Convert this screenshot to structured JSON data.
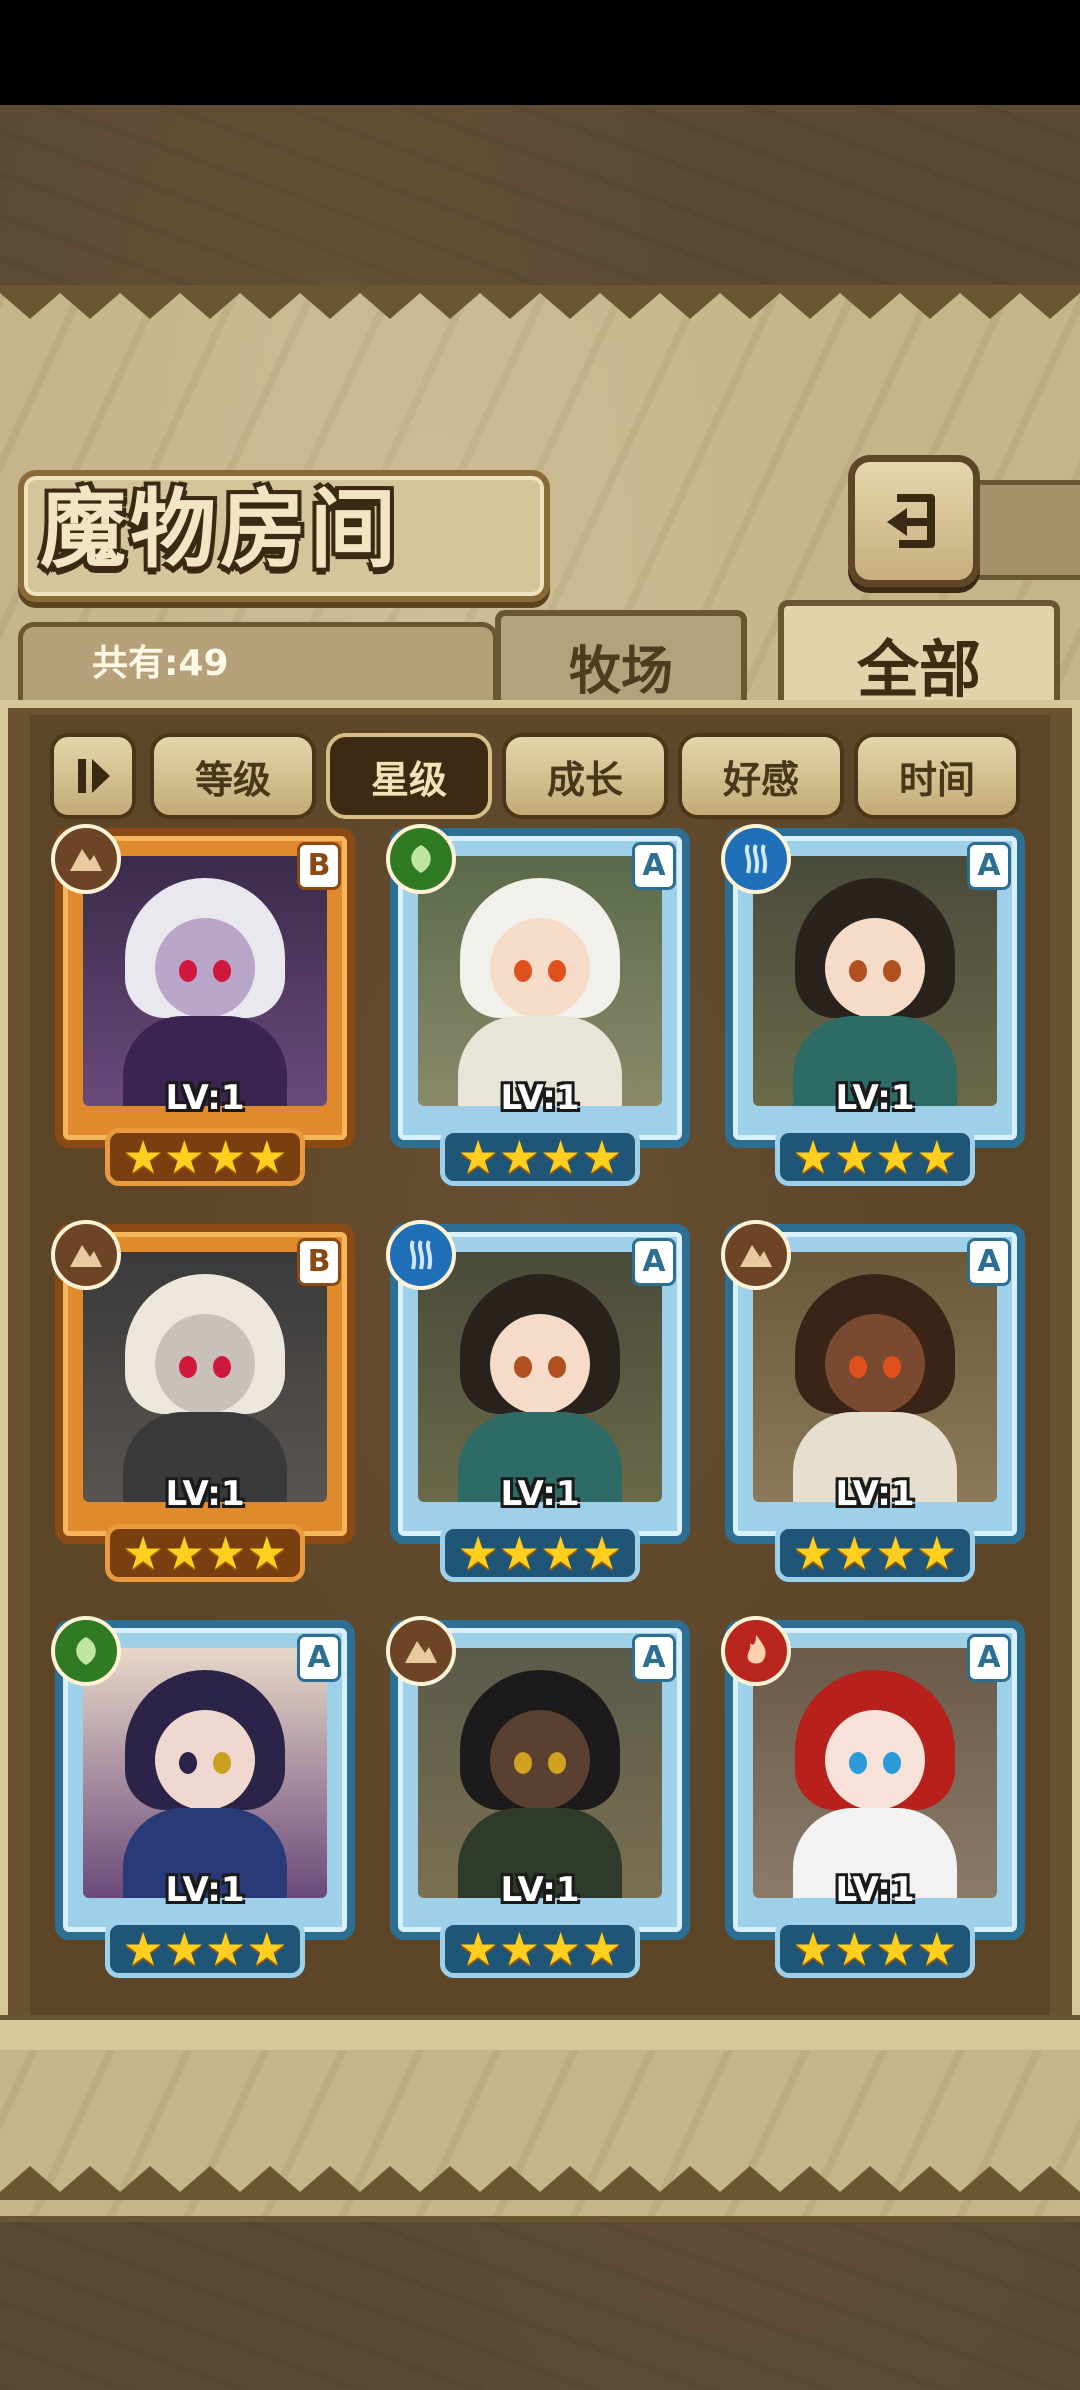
{
  "header": {
    "title": "魔物房间",
    "back_icon": "return-arrow-icon"
  },
  "summary": {
    "count_label": "共有:49"
  },
  "tabs": [
    {
      "label": "牧场",
      "selected": false
    },
    {
      "label": "全部",
      "selected": true
    }
  ],
  "sort": {
    "toggle_icon": "sort-direction-icon",
    "buttons": [
      {
        "label": "等级",
        "active": false
      },
      {
        "label": "星级",
        "active": true
      },
      {
        "label": "成长",
        "active": false
      },
      {
        "label": "好感",
        "active": false
      },
      {
        "label": "时间",
        "active": false
      }
    ]
  },
  "monsters": [
    {
      "grade": "B",
      "level": "LV:1",
      "stars": "★★★★",
      "element": "earth",
      "frame": "orange"
    },
    {
      "grade": "A",
      "level": "LV:1",
      "stars": "★★★★",
      "element": "leaf",
      "frame": "blue"
    },
    {
      "grade": "A",
      "level": "LV:1",
      "stars": "★★★★",
      "element": "water",
      "frame": "blue"
    },
    {
      "grade": "B",
      "level": "LV:1",
      "stars": "★★★★",
      "element": "earth",
      "frame": "orange"
    },
    {
      "grade": "A",
      "level": "LV:1",
      "stars": "★★★★",
      "element": "water",
      "frame": "blue"
    },
    {
      "grade": "A",
      "level": "LV:1",
      "stars": "★★★★",
      "element": "earth",
      "frame": "blue"
    },
    {
      "grade": "A",
      "level": "LV:1",
      "stars": "★★★★",
      "element": "leaf",
      "frame": "blue"
    },
    {
      "grade": "A",
      "level": "LV:1",
      "stars": "★★★★",
      "element": "earth",
      "frame": "blue"
    },
    {
      "grade": "A",
      "level": "LV:1",
      "stars": "★★★★",
      "element": "fire",
      "frame": "blue"
    }
  ],
  "colors": {
    "panel": "#c6b48a",
    "frame_orange": "#e08a2e",
    "frame_blue": "#9fd0ea",
    "star": "#ffcf1f"
  }
}
